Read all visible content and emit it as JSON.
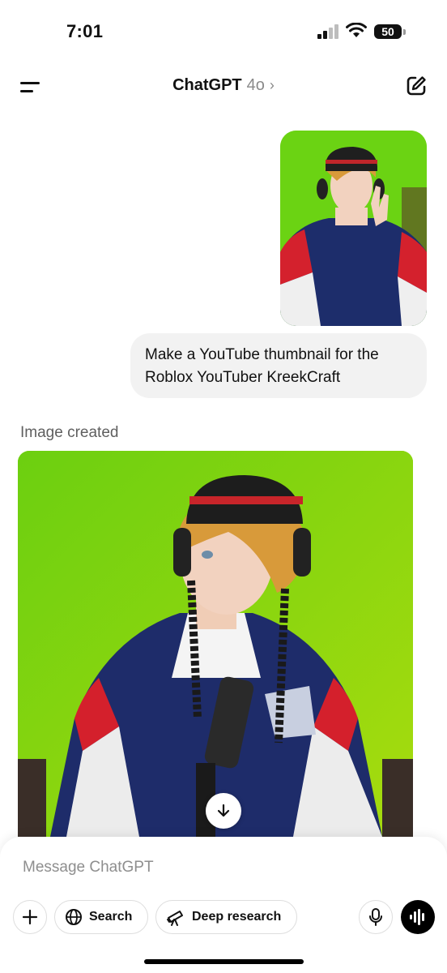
{
  "status": {
    "time": "7:01",
    "battery": "50",
    "icons": [
      "signal-icon",
      "wifi-icon",
      "battery-icon"
    ]
  },
  "header": {
    "title": "ChatGPT",
    "model": "4o",
    "icons": [
      "menu-icon",
      "chevron-right-icon",
      "new-chat-icon"
    ]
  },
  "conversation": {
    "user_image": "user-photo",
    "user_message": "Make a YouTube thumbnail for the Roblox YouTuber KreekCraft",
    "assistant_label": "Image created",
    "generated_image": "generated-thumbnail"
  },
  "composer": {
    "placeholder": "Message ChatGPT",
    "search_label": "Search",
    "deep_research_label": "Deep research",
    "icons": [
      "plus-icon",
      "globe-icon",
      "telescope-icon",
      "microphone-icon",
      "voice-waveform-icon"
    ]
  },
  "colors": {
    "green_screen": "#6bd313",
    "bubble_bg": "#f2f2f2",
    "text_primary": "#111111",
    "text_secondary": "#8a8a8a"
  }
}
